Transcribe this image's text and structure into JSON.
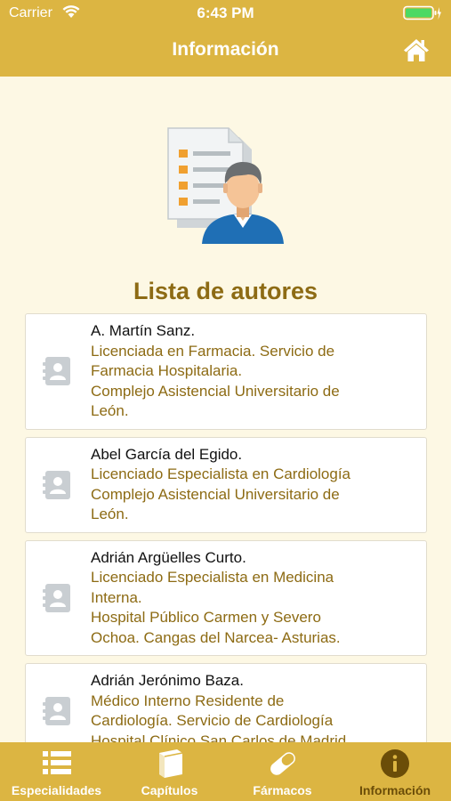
{
  "status": {
    "carrier": "Carrier",
    "time": "6:43 PM"
  },
  "header": {
    "title": "Información"
  },
  "main": {
    "section_title": "Lista de autores",
    "authors": [
      {
        "name": "A. Martín Sanz.",
        "lines": [
          "Licenciada  en Farmacia. Servicio de",
          "Farmacia Hospitalaria.",
          "Complejo Asistencial Universitario de",
          "León."
        ]
      },
      {
        "name": "Abel García del Egido.",
        "lines": [
          "Licenciado Especialista en Cardiología",
          "Complejo Asistencial Universitario de",
          "León."
        ]
      },
      {
        "name": "Adrián Argüelles Curto.",
        "lines": [
          "Licenciado Especialista en Medicina",
          "Interna.",
          "Hospital Público Carmen y Severo",
          "Ochoa. Cangas del Narcea- Asturias."
        ]
      },
      {
        "name": "Adrián Jerónimo Baza.",
        "lines": [
          "Médico Interno Residente de",
          "Cardiología. Servicio de Cardiología",
          "Hospital Clínico San Carlos de Madrid"
        ]
      }
    ]
  },
  "tabbar": {
    "tabs": [
      {
        "label": "Especialidades",
        "icon": "list-icon"
      },
      {
        "label": "Capítulos",
        "icon": "book-icon"
      },
      {
        "label": "Fármacos",
        "icon": "pill-icon"
      },
      {
        "label": "Información",
        "icon": "info-icon",
        "active": true
      }
    ]
  },
  "colors": {
    "accent": "#dcb542",
    "text_accent": "#8d6b14",
    "background": "#fdf8e4",
    "active_tab": "#6b4d08"
  }
}
